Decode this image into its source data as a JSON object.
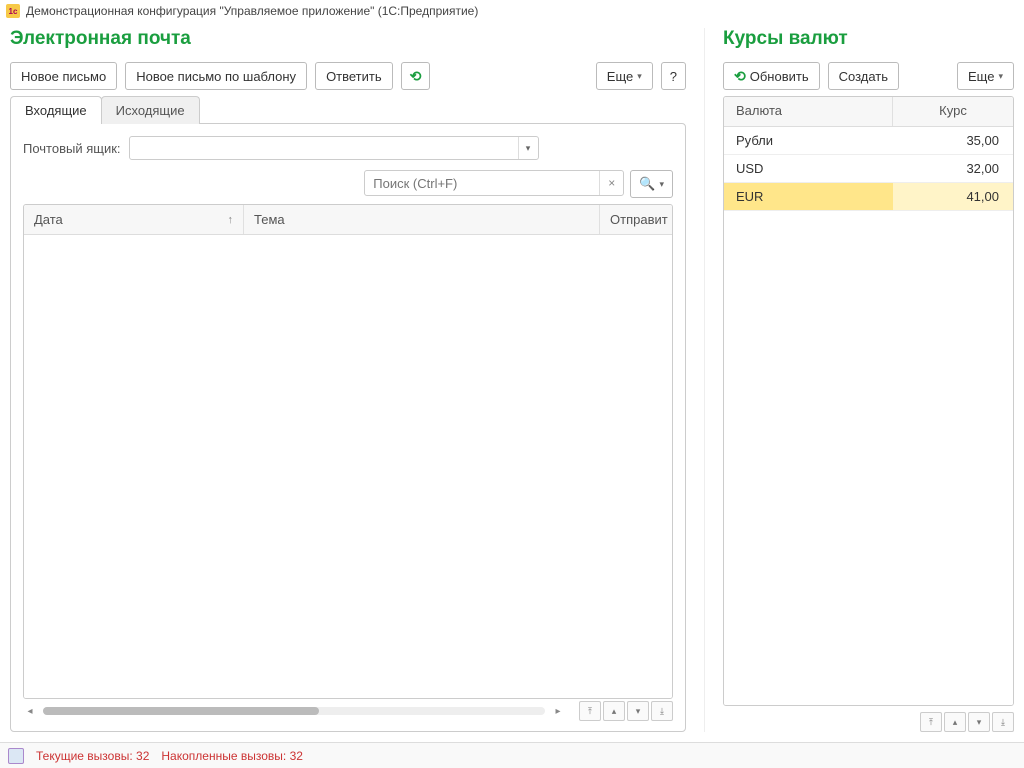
{
  "window": {
    "title": "Демонстрационная конфигурация \"Управляемое приложение\"  (1С:Предприятие)"
  },
  "email": {
    "title": "Электронная почта",
    "buttons": {
      "new": "Новое письмо",
      "new_template": "Новое письмо по шаблону",
      "reply": "Ответить",
      "more": "Еще",
      "help": "?"
    },
    "tabs": {
      "inbox": "Входящие",
      "outbox": "Исходящие"
    },
    "mailbox_label": "Почтовый ящик:",
    "search_placeholder": "Поиск (Ctrl+F)",
    "columns": {
      "date": "Дата",
      "subject": "Тема",
      "sender": "Отправит"
    }
  },
  "rates": {
    "title": "Курсы валют",
    "buttons": {
      "refresh": "Обновить",
      "create": "Создать",
      "more": "Еще"
    },
    "columns": {
      "currency": "Валюта",
      "rate": "Курс"
    },
    "rows": [
      {
        "currency": "Рубли",
        "rate": "35,00",
        "selected": false
      },
      {
        "currency": "USD",
        "rate": "32,00",
        "selected": false
      },
      {
        "currency": "EUR",
        "rate": "41,00",
        "selected": true
      }
    ]
  },
  "status": {
    "current_label": "Текущие вызовы:",
    "current_value": "32",
    "accum_label": "Накопленные вызовы:",
    "accum_value": "32"
  }
}
